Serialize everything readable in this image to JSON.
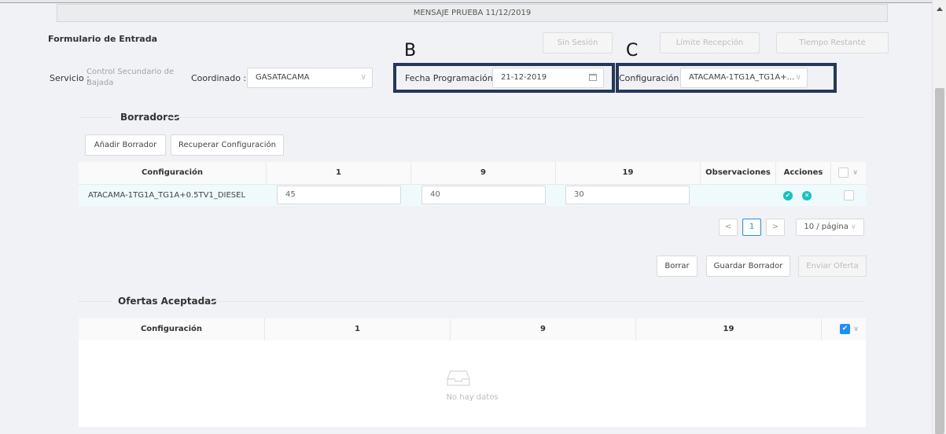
{
  "banner": {
    "message": "MENSAJE PRUEBA 11/12/2019"
  },
  "form": {
    "title": "Formulario de Entrada"
  },
  "status_buttons": {
    "session": "Sin Sesión",
    "limit": "Límite Recepción",
    "time": "Tiempo Restante"
  },
  "annotations": {
    "b": "B",
    "c": "C",
    "box_color": "#23385b"
  },
  "fields": {
    "servicio_label": "Servicio :",
    "servicio_value_line1": "Control Secundario de",
    "servicio_value_line2": "Bajada",
    "coordinado_label": "Coordinado :",
    "coordinado_value": "GASATACAMA",
    "fecha_label": "Fecha Programación :",
    "fecha_value": "21-12-2019",
    "config_label": "Configuración :",
    "config_value": "ATACAMA-1TG1A_TG1A+..."
  },
  "borradores": {
    "title": "Borradores",
    "add_button": "Añadir Borrador",
    "recover_button": "Recuperar Configuración",
    "columns": [
      "Configuración",
      "1",
      "9",
      "19",
      "Observaciones",
      "Acciones"
    ],
    "rows": [
      {
        "config": "ATACAMA-1TG1A_TG1A+0.5TV1_DIESEL",
        "v1": "45",
        "v9": "40",
        "v19": "30",
        "obs": ""
      }
    ],
    "pagination": {
      "prev": "<",
      "page": "1",
      "next": ">",
      "page_size": "10 / página"
    },
    "delete_button": "Borrar",
    "save_button": "Guardar Borrador",
    "send_button": "Enviar Oferta"
  },
  "ofertas": {
    "title": "Ofertas Aceptadas",
    "columns": [
      "Configuración",
      "1",
      "9",
      "19"
    ],
    "empty_text": "No hay datos"
  },
  "icons": {
    "chevron": "∨",
    "check": "✔",
    "close": "✕",
    "accent": "#1890ff",
    "approve_color": "#52c41a",
    "reject_color": "#13c2c2"
  }
}
